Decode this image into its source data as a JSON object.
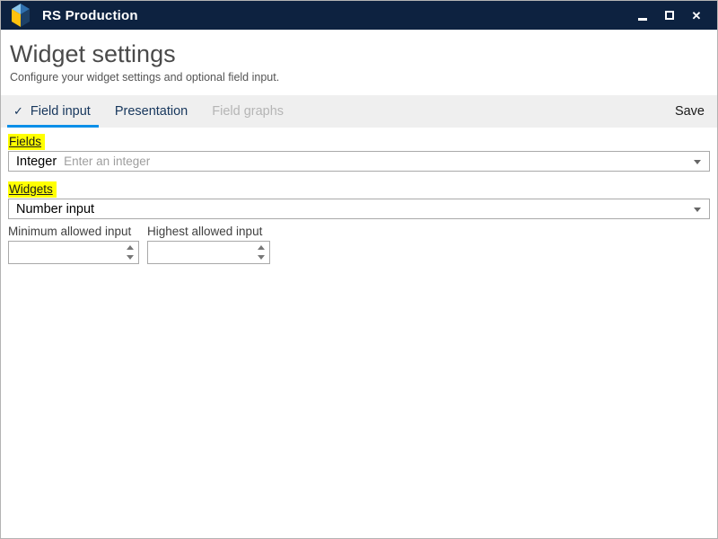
{
  "window": {
    "title": "RS Production",
    "titlebar_color": "#0d2240"
  },
  "header": {
    "title": "Widget settings",
    "subtitle": "Configure your widget settings and optional field input."
  },
  "tabs": {
    "items": [
      {
        "label": "Field input",
        "state": "active",
        "icon": "checkmark"
      },
      {
        "label": "Presentation",
        "state": "enabled"
      },
      {
        "label": "Field graphs",
        "state": "disabled"
      }
    ],
    "save_label": "Save",
    "active_underline_color": "#0a8fe8",
    "checkmark": "✓"
  },
  "form": {
    "highlight_color": "#ffff00",
    "fields": {
      "label": "Fields",
      "selected_value": "Integer",
      "placeholder": "Enter an integer"
    },
    "widgets": {
      "label": "Widgets",
      "selected_value": "Number input"
    },
    "minimum": {
      "label": "Minimum allowed input",
      "value": ""
    },
    "maximum": {
      "label": "Highest allowed input",
      "value": ""
    }
  },
  "logo_colors": {
    "top_left": "#8cc7ea",
    "top_right": "#2f6fad",
    "bottom_left": "#ffc20e",
    "bottom_right": "#1d4066"
  }
}
